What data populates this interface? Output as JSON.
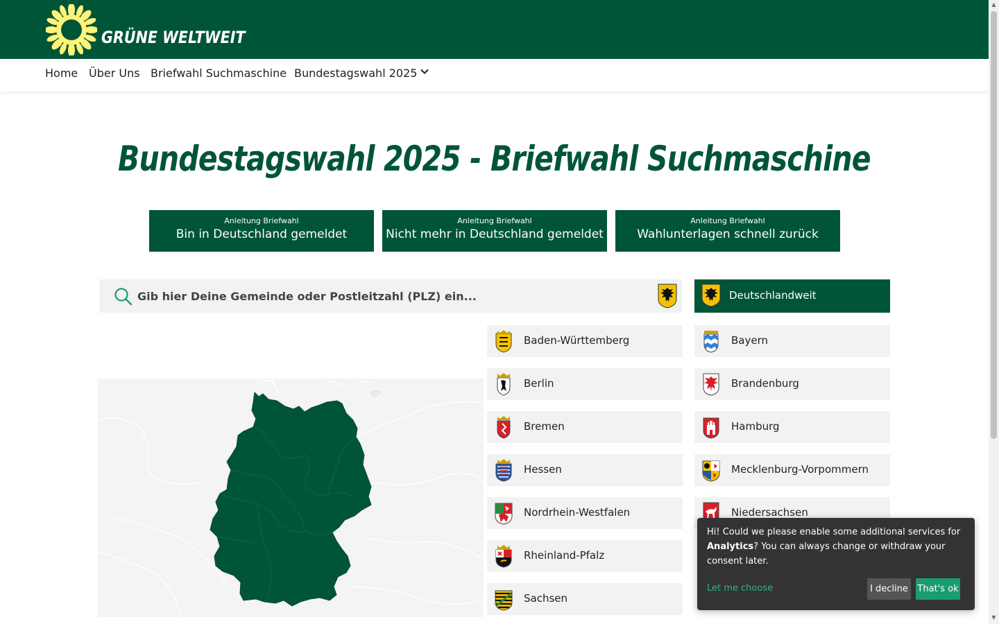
{
  "brand": {
    "name": "GRÜNE WELTWEIT",
    "logo_icon": "sunflower-icon",
    "header_color": "#005538"
  },
  "nav": {
    "items": [
      {
        "label": "Home"
      },
      {
        "label": "Über Uns"
      },
      {
        "label": "Briefwahl Suchmaschine"
      },
      {
        "label": "Bundestagswahl 2025",
        "dropdown_icon": "chevron-down-icon"
      }
    ]
  },
  "page": {
    "title": "Bundestagswahl 2025 - Briefwahl Suchmaschine"
  },
  "guides": [
    {
      "small": "Anleitung Briefwahl",
      "big": "Bin in Deutschland gemeldet"
    },
    {
      "small": "Anleitung Briefwahl",
      "big": "Nicht mehr in Deutschland gemeldet"
    },
    {
      "small": "Anleitung Briefwahl",
      "big": "Wahlunterlagen schnell zurück"
    }
  ],
  "search": {
    "placeholder": "Gib hier Deine Gemeinde oder Postleitzahl (PLZ) ein...",
    "icon": "search-icon",
    "crest_icon": "federal-eagle-icon"
  },
  "states": {
    "nationwide": "Deutschlandweit",
    "left": [
      "Baden-Württemberg",
      "Berlin",
      "Bremen",
      "Hessen",
      "Nordrhein-Westfalen",
      "Rheinland-Pfalz",
      "Sachsen"
    ],
    "right": [
      "Bayern",
      "Brandenburg",
      "Hamburg",
      "Mecklenburg-Vorpommern",
      "Niedersachsen"
    ]
  },
  "cookie": {
    "text_before": "Hi! Could we please enable some additional services for ",
    "text_bold": "Analytics",
    "text_after": "? You can always change or withdraw your consent later.",
    "choose": "Let me choose",
    "decline": "I decline",
    "accept": "That's ok"
  },
  "colors": {
    "primary": "#005538",
    "state_bg": "#f2f2f2",
    "cookie_bg": "#333333",
    "cookie_accent": "#1b9c6f"
  }
}
